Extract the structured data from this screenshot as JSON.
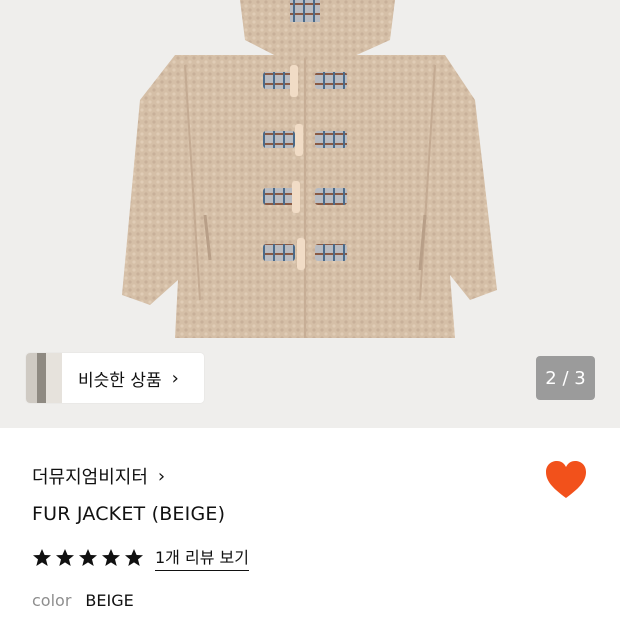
{
  "product_image": {
    "counter": "2 / 3",
    "similar_products_label": "비슷한 상품"
  },
  "product": {
    "brand": "더뮤지엄비지터",
    "title": "FUR JACKET (BEIGE)",
    "rating_stars": 5,
    "review_link": "1개 리뷰 보기",
    "color_label": "color",
    "color_value": "BEIGE"
  },
  "colors": {
    "heart": "#f2511b",
    "hero_bg": "#efeeec",
    "counter_bg": "#9b9b9b",
    "jacket": "#d4bea6"
  },
  "icons": {
    "chevron": "chevron-right-icon",
    "wishlist": "heart-icon",
    "rating": "star-icon"
  }
}
